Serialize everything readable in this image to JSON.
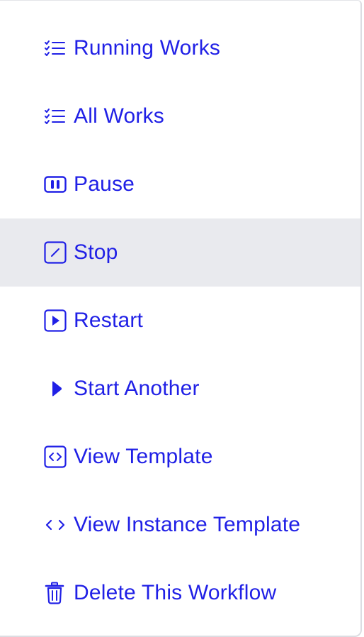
{
  "menu": {
    "accent_color": "#2020e6",
    "active_background": "#e9eaee",
    "items": [
      {
        "label": "Running Works",
        "icon": "list-check-icon"
      },
      {
        "label": "All Works",
        "icon": "list-check-icon"
      },
      {
        "label": "Pause",
        "icon": "pause-icon"
      },
      {
        "label": "Stop",
        "icon": "stop-icon",
        "active": true
      },
      {
        "label": "Restart",
        "icon": "restart-icon"
      },
      {
        "label": "Start Another",
        "icon": "play-icon"
      },
      {
        "label": "View Template",
        "icon": "code-box-icon"
      },
      {
        "label": "View Instance Template",
        "icon": "code-icon"
      },
      {
        "label": "Delete This Workflow",
        "icon": "trash-icon"
      }
    ]
  }
}
